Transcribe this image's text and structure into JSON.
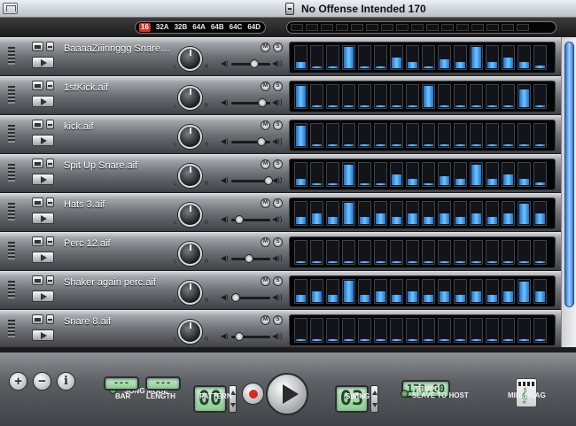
{
  "window": {
    "title": "No Offense Intended 170"
  },
  "patterns": {
    "items": [
      "16",
      "32A",
      "32B",
      "64A",
      "64B",
      "64C",
      "64D"
    ],
    "selected": "16"
  },
  "tracks": [
    {
      "name": "BaaaaZiiinnggg Snare.aif",
      "volume": 0.58,
      "steps": [
        0.35,
        0.15,
        0.15,
        1.0,
        0.15,
        0.15,
        0.55,
        0.35,
        0.15,
        0.45,
        0.35,
        1.0,
        0.35,
        0.55,
        0.35,
        0.2
      ]
    },
    {
      "name": "1stKick.aif",
      "volume": 0.8,
      "steps": [
        1.0,
        0.15,
        0.15,
        0.15,
        0.15,
        0.15,
        0.15,
        0.15,
        1.0,
        0.15,
        0.15,
        0.15,
        0.15,
        0.15,
        0.85,
        0.15
      ]
    },
    {
      "name": "kick.aif",
      "volume": 0.78,
      "steps": [
        0.95,
        0.15,
        0.15,
        0.15,
        0.15,
        0.15,
        0.15,
        0.15,
        0.15,
        0.15,
        0.15,
        0.15,
        0.15,
        0.15,
        0.15,
        0.15
      ]
    },
    {
      "name": "Spit Up Snare.aif",
      "volume": 0.95,
      "steps": [
        0.35,
        0.15,
        0.15,
        0.95,
        0.15,
        0.15,
        0.55,
        0.35,
        0.15,
        0.45,
        0.35,
        0.95,
        0.35,
        0.55,
        0.35,
        0.2
      ]
    },
    {
      "name": "Hats 3.aif",
      "volume": 0.2,
      "steps": [
        0.4,
        0.55,
        0.4,
        1.0,
        0.4,
        0.55,
        0.4,
        0.55,
        0.4,
        0.55,
        0.4,
        0.55,
        0.4,
        0.55,
        0.95,
        0.55
      ]
    },
    {
      "name": "Perc 12.aif",
      "volume": 0.45,
      "steps": [
        0.15,
        0.15,
        0.15,
        0.15,
        0.15,
        0.15,
        0.15,
        0.15,
        0.15,
        0.15,
        0.15,
        0.15,
        0.15,
        0.15,
        0.15,
        0.15
      ]
    },
    {
      "name": "Shaker again perc.aif",
      "volume": 0.12,
      "steps": [
        0.4,
        0.55,
        0.4,
        1.0,
        0.4,
        0.55,
        0.4,
        0.55,
        0.4,
        0.55,
        0.4,
        0.55,
        0.4,
        0.55,
        0.95,
        0.55
      ]
    },
    {
      "name": "Snare 8.aif",
      "volume": 0.2,
      "steps": [
        0.15,
        0.15,
        0.15,
        0.15,
        0.15,
        0.15,
        0.15,
        0.15,
        0.15,
        0.15,
        0.15,
        0.15,
        0.15,
        0.15,
        0.15,
        0.15
      ]
    }
  ],
  "track_labels": {
    "mute": "M",
    "solo": "S",
    "left": "L",
    "right": "R",
    "vol_min": "◀)",
    "vol_max": "◀))"
  },
  "transport": {
    "song_mode": "SONG MODE",
    "bar_label": "BAR",
    "length_label": "LENGTH",
    "bar_value": "---",
    "length_value": "---",
    "pattern_value": "00",
    "pattern_label": "PATTERN",
    "swing_value": "03",
    "swing_label": "SWING",
    "tempo_value": "170.00",
    "tempo_label": "TEMPO",
    "slave_label": "SLAVE TO HOST",
    "midi_drag_label": "MIDI DRAG",
    "add_label": "+",
    "remove_label": "−",
    "info_label": "i"
  },
  "colors": {
    "step_active": "#5bb8ff",
    "led": "#4fa54f",
    "record": "#d62a1e"
  }
}
